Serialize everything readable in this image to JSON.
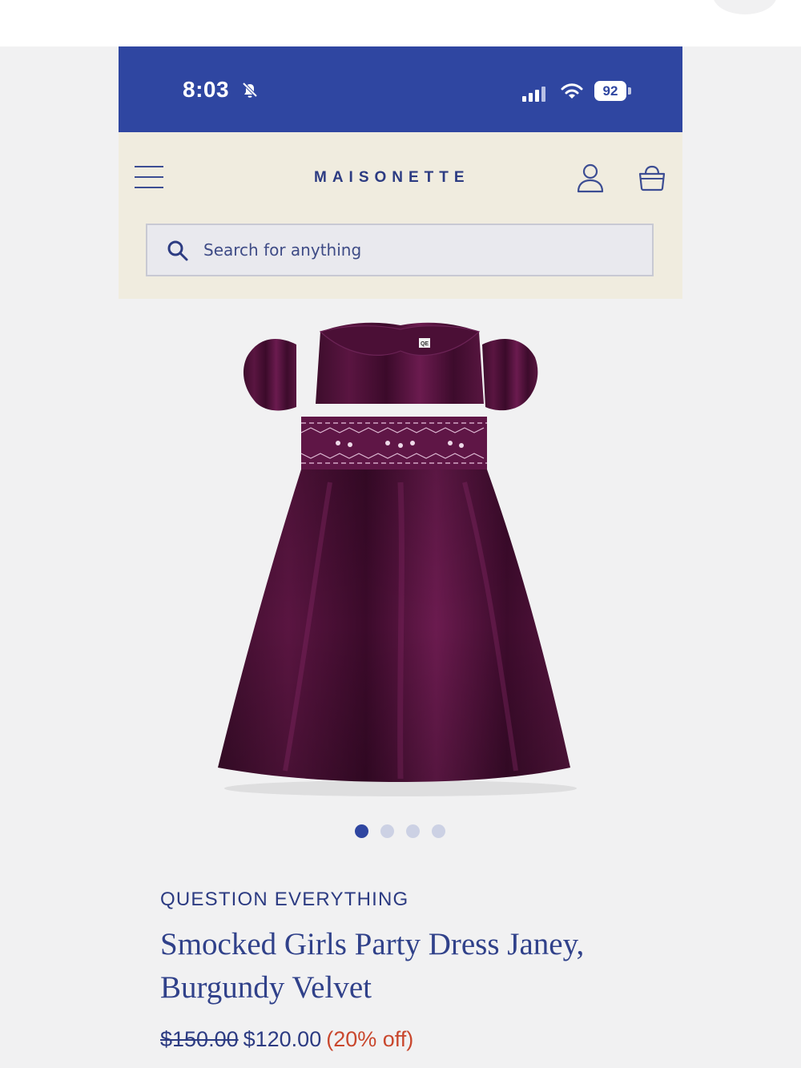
{
  "status_bar": {
    "time": "8:03",
    "battery": "92"
  },
  "header": {
    "brand": "MAISONETTE"
  },
  "search": {
    "placeholder": "Search for anything"
  },
  "carousel": {
    "count": 4,
    "active_index": 0
  },
  "product": {
    "brand": "QUESTION EVERYTHING",
    "title": "Smocked Girls Party Dress Janey, Burgundy Velvet",
    "original_price": "$150.00",
    "sale_price": "$120.00",
    "discount": "(20% off)"
  },
  "colors": {
    "primary_blue": "#2f46a1",
    "header_cream": "#f0ecdf",
    "background": "#f1f1f2",
    "discount_red": "#c9472d",
    "dress_burgundy": "#4a0f33"
  },
  "icons": [
    "bell-slash-icon",
    "signal-icon",
    "wifi-icon",
    "battery-icon",
    "menu-icon",
    "account-icon",
    "bag-icon",
    "search-icon"
  ]
}
